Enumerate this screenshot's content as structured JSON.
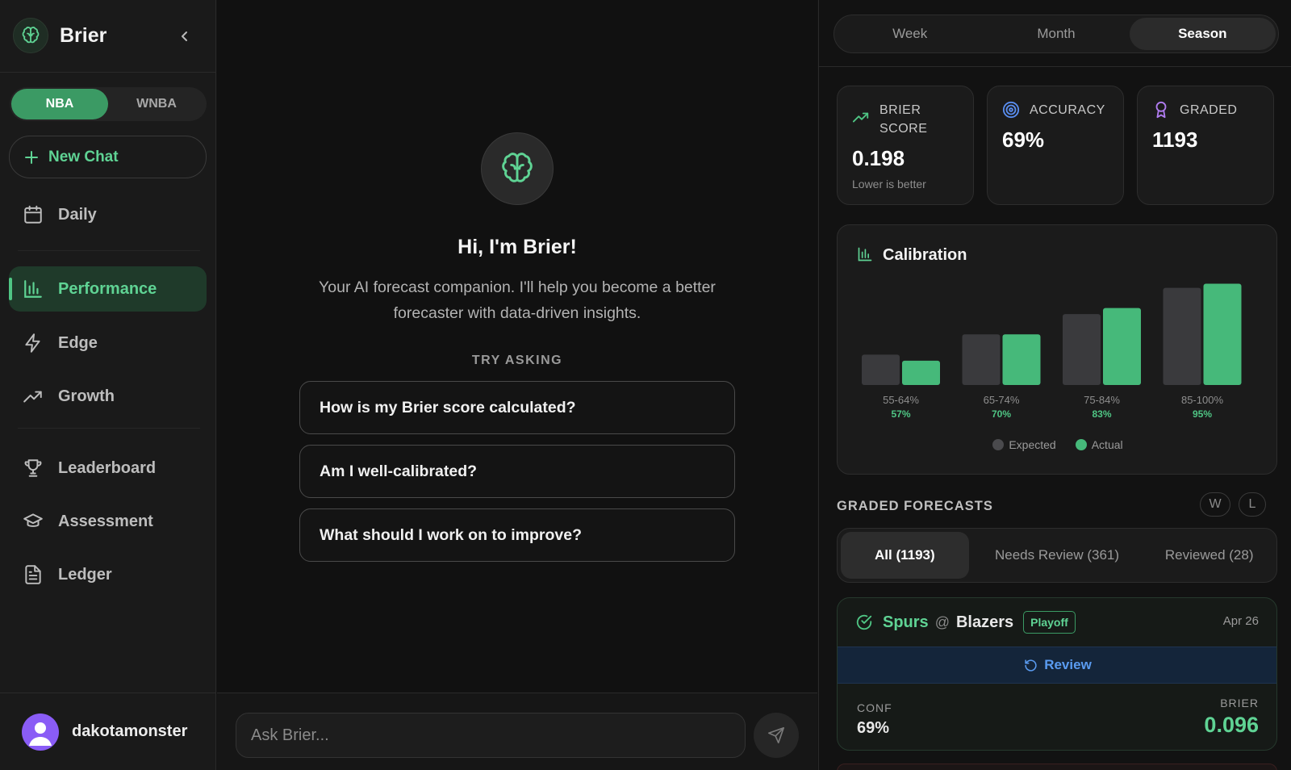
{
  "app": {
    "name": "Brier"
  },
  "sidebar": {
    "leagues": [
      "NBA",
      "WNBA"
    ],
    "active_league": "NBA",
    "new_chat_label": "New Chat",
    "items": [
      {
        "label": "Daily",
        "icon": "calendar-icon"
      },
      {
        "label": "Performance",
        "icon": "bar-chart-icon",
        "active": true
      },
      {
        "label": "Edge",
        "icon": "lightning-icon"
      },
      {
        "label": "Growth",
        "icon": "trending-up-icon"
      },
      {
        "label": "Leaderboard",
        "icon": "trophy-icon"
      },
      {
        "label": "Assessment",
        "icon": "graduation-cap-icon"
      },
      {
        "label": "Ledger",
        "icon": "document-icon"
      }
    ],
    "user": {
      "name": "dakotamonster"
    }
  },
  "chat": {
    "title": "Hi, I'm Brier!",
    "subtitle": "Your AI forecast companion. I'll help you become a better forecaster with data-driven insights.",
    "try_label": "TRY ASKING",
    "suggestions": [
      "How is my Brier score calculated?",
      "Am I well-calibrated?",
      "What should I work on to improve?"
    ],
    "input_placeholder": "Ask Brier..."
  },
  "performance": {
    "periods": [
      "Week",
      "Month",
      "Season"
    ],
    "active_period": "Season",
    "stats": [
      {
        "label": "BRIER SCORE",
        "value": "0.198",
        "note": "Lower is better",
        "icon": "trend-icon",
        "color": "#4fc584"
      },
      {
        "label": "ACCURACY",
        "value": "69%",
        "note": "",
        "icon": "target-icon",
        "color": "#5a8ef0"
      },
      {
        "label": "GRADED",
        "value": "1193",
        "note": "",
        "icon": "award-icon",
        "color": "#b07cf0"
      }
    ],
    "calibration": {
      "title": "Calibration",
      "legend_expected": "Expected",
      "legend_actual": "Actual"
    },
    "graded": {
      "label": "GRADED FORECASTS",
      "wl": [
        "W",
        "L"
      ],
      "tabs": [
        "All (1193)",
        "Needs Review (361)",
        "Reviewed (28)"
      ],
      "active_tab": 0,
      "forecast": {
        "team1": "Spurs",
        "at": "@",
        "team2": "Blazers",
        "badge": "Playoff",
        "date": "Apr 26",
        "review_label": "Review",
        "conf_label": "CONF",
        "conf_value": "69%",
        "brier_label": "BRIER",
        "brier_value": "0.096"
      }
    }
  },
  "chart_data": {
    "type": "bar",
    "title": "Calibration",
    "categories": [
      "55-64%",
      "65-74%",
      "75-84%",
      "85-100%"
    ],
    "category_labels": [
      "57%",
      "70%",
      "83%",
      "95%"
    ],
    "series": [
      {
        "name": "Expected",
        "values": [
          60,
          70,
          80,
          93
        ],
        "color": "#3a3a3d"
      },
      {
        "name": "Actual",
        "values": [
          57,
          70,
          83,
          95
        ],
        "color": "#46b97a"
      }
    ],
    "ylim": [
      0,
      100
    ],
    "legend": "bottom-center",
    "grid": false
  }
}
